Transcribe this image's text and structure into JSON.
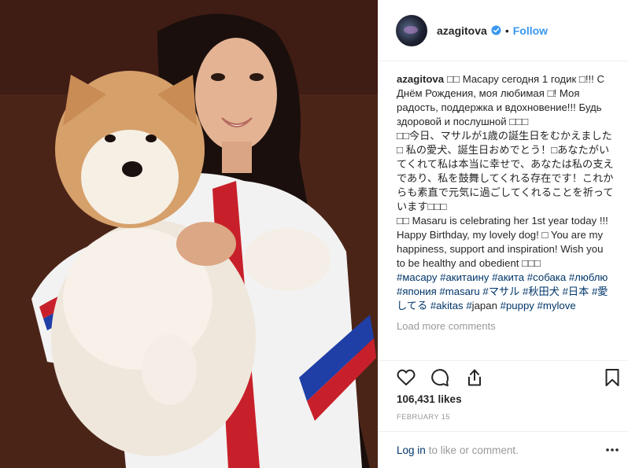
{
  "header": {
    "username": "azagitova",
    "separator": "•",
    "follow_label": "Follow"
  },
  "caption": {
    "username": "azagitova",
    "paragraphs": [
      "□□ Масару сегодня 1 годик □!!! С Днём Рождения, моя любимая □! Моя радость, поддержка и вдохновение!!! Будь здоровой и послушной □□□",
      "□□今日、マサルが1歳の誕生日をむかえました□ 私の愛犬、誕生日おめでとう！□あなたがいてくれて私は本当に幸せで、あなたは私の支えであり、私を鼓舞してくれる存在です！これからも素直で元気に過ごしてくれることを祈っています□□□",
      "□□ Masaru is celebrating her 1st year today !!! Happy Birthday, my lovely dog! □ You are my happiness, support and inspiration! Wish you to be healthy and obedient □□□"
    ],
    "hashtags": [
      "#масару",
      "#акитаину",
      "#акита",
      "#собака",
      "#люблю",
      "#япония",
      "#masaru",
      "#マサル",
      "#秋田犬",
      "#日本",
      "#愛してる",
      "#akitas",
      "#",
      "japan",
      "#puppy",
      "#mylove"
    ]
  },
  "load_more_label": "Load more comments",
  "likes_label": "106,431 likes",
  "date_label": "FEBRUARY 15",
  "login": {
    "link_label": "Log in",
    "suffix": "to like or comment."
  },
  "icons": {
    "like": "heart-icon",
    "comment": "comment-icon",
    "share": "share-icon",
    "save": "bookmark-icon",
    "more": "more-options-icon",
    "verified": "verified-badge-icon"
  },
  "colors": {
    "link_blue": "#3897f0",
    "tag_blue": "#003569",
    "muted": "#999999",
    "text": "#262626",
    "verified": "#3897f0"
  }
}
